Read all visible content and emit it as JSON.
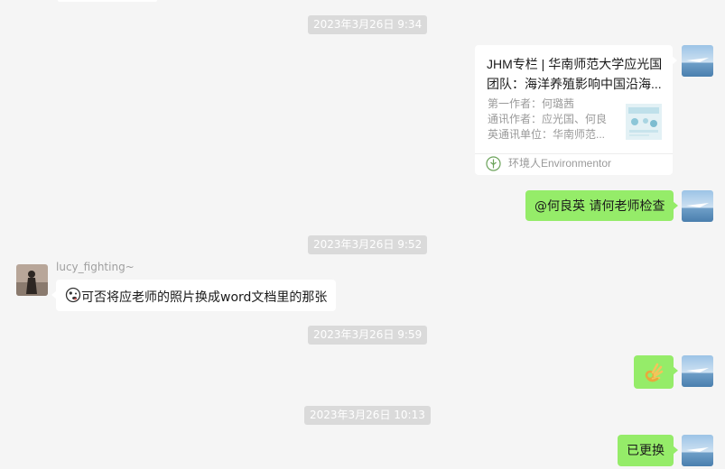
{
  "timestamps": [
    "2023年3月26日 9:34",
    "2023年3月26日 9:52",
    "2023年3月26日 9:59",
    "2023年3月26日 10:13"
  ],
  "link_card": {
    "title_line1": "JHM专栏 | 华南师范大学应光国",
    "title_line2": "团队：海洋养殖影响中国沿海...",
    "desc_line1": "第一作者：何璐茜",
    "desc_line2": "通讯作者：应光国、何良",
    "desc_line3": "英通讯单位：华南师范...",
    "source": "环境人Environmentor"
  },
  "messages": {
    "mention": "@何良英 请何老师检查",
    "other_sender": "lucy_fighting~",
    "other_text": "可否将应老师的照片换成word文档里的那张",
    "other_emoji": "grimace-emoji",
    "ok_emoji": "ok-hand-emoji",
    "replaced": "已更换"
  },
  "colors": {
    "background": "#f5f5f5",
    "my_bubble": "#95ec69",
    "other_bubble": "#ffffff",
    "timestamp_bg": "#dadada"
  }
}
